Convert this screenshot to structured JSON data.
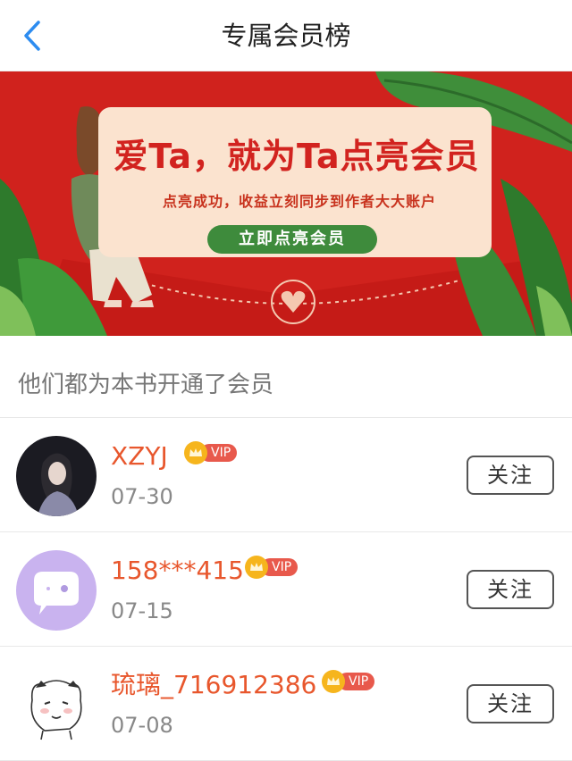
{
  "header": {
    "title": "专属会员榜"
  },
  "banner": {
    "title": "爱Ta，就为Ta点亮会员",
    "subtitle": "点亮成功，收益立刻同步到作者大大账户",
    "cta": "立即点亮会员"
  },
  "section": {
    "heading": "他们都为本书开通了会员"
  },
  "members": [
    {
      "name": "XZYJ",
      "badge": "VIP",
      "date": "07-30",
      "follow_label": "关注"
    },
    {
      "name": "158***415",
      "badge": "VIP",
      "date": "07-15",
      "follow_label": "关注"
    },
    {
      "name": "琉璃_716912386",
      "badge": "VIP",
      "date": "07-08",
      "follow_label": "关注"
    }
  ],
  "colors": {
    "accent_blue": "#2d8cf0",
    "name_orange": "#e8572d",
    "banner_red": "#d0221d",
    "vip_red": "#e8594c",
    "crown_gold": "#f6b51d"
  },
  "icons": {
    "back": "chevron-left-icon",
    "crown": "crown-icon",
    "heart": "heart-icon"
  }
}
